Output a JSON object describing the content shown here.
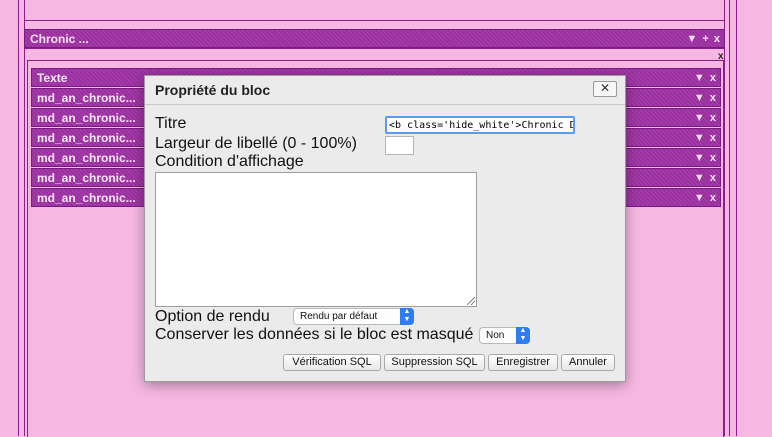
{
  "top_panel": {
    "bar_title": "Chronic ...",
    "controls": [
      "▼",
      "+",
      "x"
    ],
    "close_glyph": "x"
  },
  "sub_bars": [
    {
      "label": "Texte",
      "controls": [
        "▼",
        "x"
      ]
    },
    {
      "label": "md_an_chronic...",
      "controls": [
        "▼",
        "x"
      ]
    },
    {
      "label": "md_an_chronic...",
      "controls": [
        "▼",
        "x"
      ]
    },
    {
      "label": "md_an_chronic...",
      "controls": [
        "▼",
        "x"
      ]
    },
    {
      "label": "md_an_chronic...",
      "controls": [
        "▼",
        "x"
      ]
    },
    {
      "label": "md_an_chronic...",
      "controls": [
        "▼",
        "x"
      ]
    },
    {
      "label": "md_an_chronic...",
      "controls": [
        "▼",
        "x"
      ]
    }
  ],
  "dialog": {
    "title": "Propriété du bloc",
    "close_glyph": "✕",
    "fields": {
      "titre_label": "Titre",
      "titre_value": "<b class='hide_white'>Chronic Dese",
      "largeur_label": "Largeur de libellé (0 - 100%)",
      "largeur_value": "",
      "condition_label": "Condition d'affichage",
      "condition_value": "",
      "option_label": "Option de rendu",
      "option_value": "Rendu par défaut",
      "conserver_label": "Conserver les données si le bloc est masqué",
      "conserver_value": "Non"
    },
    "buttons": {
      "verif": "Vérification SQL",
      "suppr": "Suppression SQL",
      "save": "Enregistrer",
      "cancel": "Annuler"
    }
  },
  "colors": {
    "background": "#f6b8e2",
    "bar": "#9b2fa0",
    "accent_blue": "#2f7df2"
  }
}
